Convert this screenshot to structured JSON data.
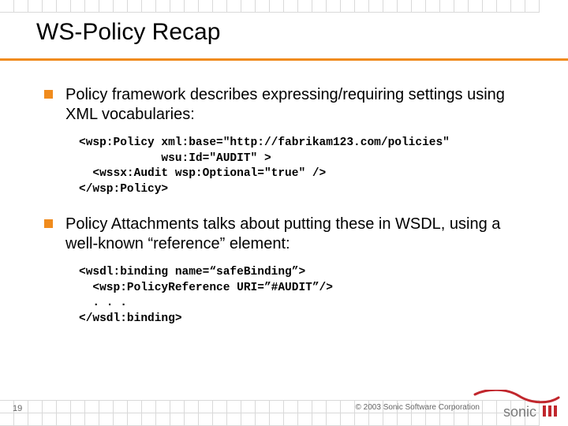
{
  "title": "WS-Policy Recap",
  "bullets": [
    {
      "text": "Policy framework describes expressing/requiring settings using XML vocabularies:"
    },
    {
      "text": "Policy Attachments talks about putting these in WSDL, using a well-known “reference” element:"
    }
  ],
  "code_blocks": [
    "<wsp:Policy xml:base=\"http://fabrikam123.com/policies\"\n            wsu:Id=\"AUDIT\" >\n  <wssx:Audit wsp:Optional=\"true\" />\n</wsp:Policy>",
    "<wsdl:binding name=“safeBinding”>\n  <wsp:PolicyReference URI=”#AUDIT”/>\n  . . .\n</wsdl:binding>"
  ],
  "footer": {
    "page": "19",
    "copyright": "© 2003 Sonic Software Corporation"
  },
  "logo": {
    "brand": "sonic",
    "accent": "#c1272d"
  }
}
